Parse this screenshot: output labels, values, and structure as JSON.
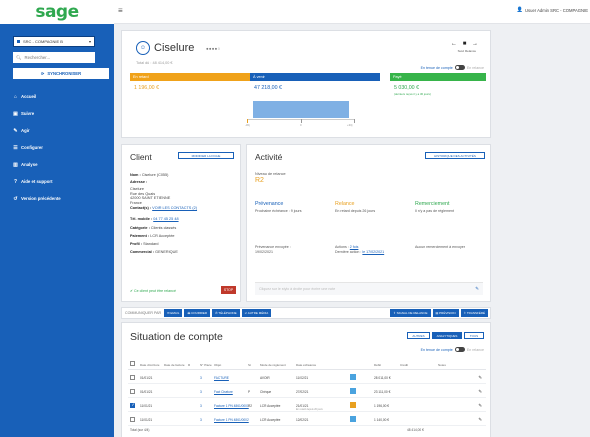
{
  "topbar": {
    "brand": "sage",
    "menu_icon": "hamburger-icon",
    "user": "Usuer Admin SRC - COMPAGNIE"
  },
  "sidebar": {
    "company": "SRC - COMPAGNIE B",
    "search_placeholder": "Rechercher...",
    "sync_label": "SYNCHRONISER",
    "items": [
      {
        "label": "Accueil",
        "icon": "home-icon"
      },
      {
        "label": "Suivre",
        "icon": "briefcase-icon"
      },
      {
        "label": "Agir",
        "icon": "edit-icon"
      },
      {
        "label": "Configurer",
        "icon": "sliders-icon"
      },
      {
        "label": "Analyse",
        "icon": "chart-icon"
      },
      {
        "label": "Aide et support",
        "icon": "help-icon"
      },
      {
        "label": "Version précédente",
        "icon": "back-icon"
      }
    ]
  },
  "header": {
    "client_name": "Ciselure",
    "stars": "●●●●○",
    "subtitle": "Total dû : 48 414,00 €",
    "nav_arrows": "← ■ →",
    "suivi": "Suivi Relance",
    "toggle_on": "En tenue de compte",
    "toggle_off": "En relance",
    "segments": {
      "retard_label": "En retard",
      "avenir_label": "À venir",
      "paye_label": "Payé"
    },
    "values": {
      "retard": "1 196,00 €",
      "avenir": "47 218,00 €",
      "paye": "5 030,00 €",
      "paye_sub": "(derniers reçus il y a 30 jours)"
    },
    "scale": [
      "-30j",
      "0",
      "+30j"
    ],
    "colors": {
      "retard": "#f0a21a",
      "avenir": "#1860b8",
      "paye": "#37b44a"
    }
  },
  "client": {
    "title": "Client",
    "button": "MODIFIER LA FICHE",
    "fields": [
      {
        "label": "Nom :",
        "value": "Ciselure (C055)"
      },
      {
        "label": "Adresse :",
        "value": ""
      },
      {
        "label": "",
        "value": "Ciselure"
      },
      {
        "label": "",
        "value": "Rue des Quais"
      },
      {
        "label": "",
        "value": "42000 SAINT ETIENNE"
      },
      {
        "label": "",
        "value": "France"
      }
    ],
    "contact_label": "Contact(s) :",
    "contact_value": "VOIR LES CONTACTS (2)",
    "phone_label": "Tél. mobile :",
    "phone_value": "04 77 45 25 48",
    "cat_label": "Catégorie :",
    "cat_value": "Clients classés",
    "pay_label": "Paiement :",
    "pay_value": "LCR Acceptée",
    "profile_label": "Profil :",
    "profile_value": "Standard",
    "commercial_label": "Commercial :",
    "commercial_value": "GENERIQUE",
    "ok_text": "✔ Ce client peut être relancé",
    "stop_button": "STOP"
  },
  "activity": {
    "title": "Activité",
    "button": "HISTORIQUE DES ACTIVITÉS",
    "count_label": "Niveau de relance",
    "count_value": "R2",
    "cols": [
      {
        "h": "Prévenance",
        "t": "Prochaine échéance : 9 jours",
        "color": "#1860b8"
      },
      {
        "h": "Relance",
        "t": "En retard depuis 26 jours",
        "color": "#e8a020"
      },
      {
        "h": "Remerciement",
        "t": "Il n'y a pas de règlement",
        "color": "#2fa84f"
      }
    ],
    "sent_label": "Prévenance envoyée :",
    "sent_value": "19/02/2021",
    "actions_label": "Actions :",
    "actions_value": "2 fois",
    "last_label": "Dernière action :",
    "last_value": "le 17/02/2021",
    "thanks": "Aucun remerciement à envoyer",
    "note_placeholder": "Cliquez sur le stylo à droite pour écrire une note"
  },
  "strip": {
    "label": "COMMUNIQUER PAR",
    "buttons": [
      "✉ EMAIL",
      "🖶 COURRIER",
      "✆ TÉLÉPHONE",
      "↩ AUTRE MÉDIA"
    ],
    "right_buttons": [
      "⇧ SIGNAL DE RELANCE",
      "▤ PRÉVISION",
      "⇧ TRANSFÉRÉ"
    ]
  },
  "situation": {
    "title": "Situation de compte",
    "tabs": [
      "AUTRES",
      "ANALYTIQUES",
      "TOUS"
    ],
    "toggle_on": "En tenue de compte",
    "toggle_off": "En relance",
    "headers": [
      "Date d'écriture",
      "Date de facture",
      "R",
      "N° Pièce",
      "Objet",
      "St",
      "Mode de règlement",
      "Date échéance",
      "Débit",
      "Crédit",
      "Notes"
    ],
    "rows": [
      {
        "checked": false,
        "date": "01/01/21",
        "num": "3",
        "objet": "FACTURE",
        "mode": "AVOIR",
        "ech": "11/02/21",
        "badge": "bl",
        "debit": "28 011,00 €"
      },
      {
        "checked": false,
        "date": "01/01/21",
        "num": "3",
        "objet": "Fact Ciselure",
        "st": "P",
        "mode": "Chèque",
        "ech": "27/02/21",
        "badge": "bl",
        "debit": "23 111,00 €"
      },
      {
        "checked": true,
        "date": "11/01/21",
        "num": "3",
        "objet": "Facture 1 PN 4861/0001",
        "st": "R2",
        "mode": "LCR Acceptée",
        "ech": "21/01/21",
        "ech2": "En retard depuis 26 jours",
        "badge": "or",
        "debit": "1 196,00 €"
      },
      {
        "checked": false,
        "date": "11/01/21",
        "num": "3",
        "objet": "Facture 1 PN 4861/0002",
        "mode": "LCR Acceptée",
        "ech": "12/02/21",
        "badge": "bl",
        "debit": "1 140,00 €"
      }
    ],
    "total_label": "Total (sur 4/4)",
    "total_value": "48 414,00 €"
  }
}
